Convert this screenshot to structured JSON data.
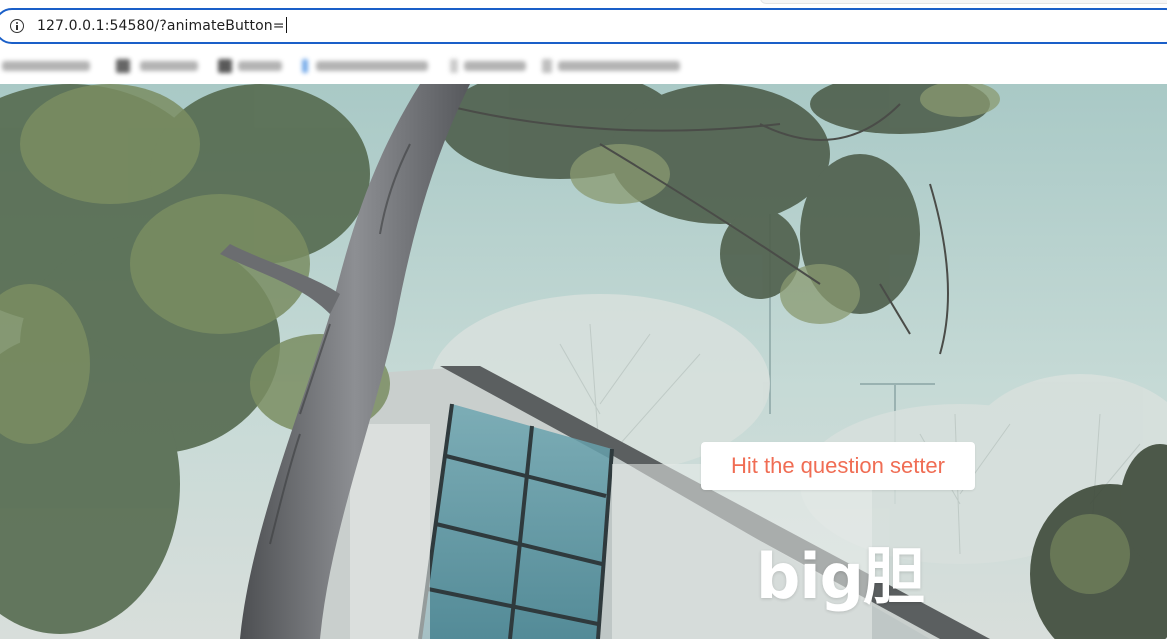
{
  "browser": {
    "url": "127.0.0.1:54580/?animateButton=",
    "icons": {
      "site_info": "info-icon"
    }
  },
  "page": {
    "button_label": "Hit the question setter",
    "headline": "big胆",
    "colors": {
      "button_text": "#f06d54",
      "button_bg": "#ffffff",
      "headline": "#ffffff",
      "address_border": "#1a5fc8"
    }
  }
}
